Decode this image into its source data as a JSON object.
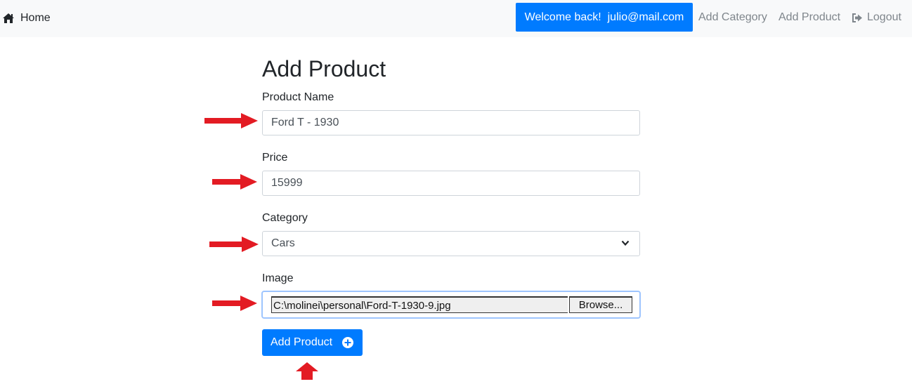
{
  "navbar": {
    "home_label": "Home",
    "welcome_text": "Welcome back!  julio@mail.com",
    "add_category": "Add Category",
    "add_product": "Add Product",
    "logout": "Logout"
  },
  "form": {
    "title": "Add Product",
    "product_name": {
      "label": "Product Name",
      "value": "Ford T - 1930"
    },
    "price": {
      "label": "Price",
      "value": "15999"
    },
    "category": {
      "label": "Category",
      "value": "Cars"
    },
    "image": {
      "label": "Image",
      "file": "C:\\molinei\\personal\\Ford-T-1930-9.jpg",
      "browse": "Browse..."
    },
    "submit": "Add Product"
  },
  "colors": {
    "primary": "#007bff",
    "navbar_bg": "#f8f9fa",
    "nav_link": "#7f868c",
    "annotation_arrow": "#e31b23"
  },
  "icons": [
    "home-icon",
    "logout-icon",
    "chevron-down-icon",
    "plus-circle-icon",
    "annotation-arrow"
  ]
}
